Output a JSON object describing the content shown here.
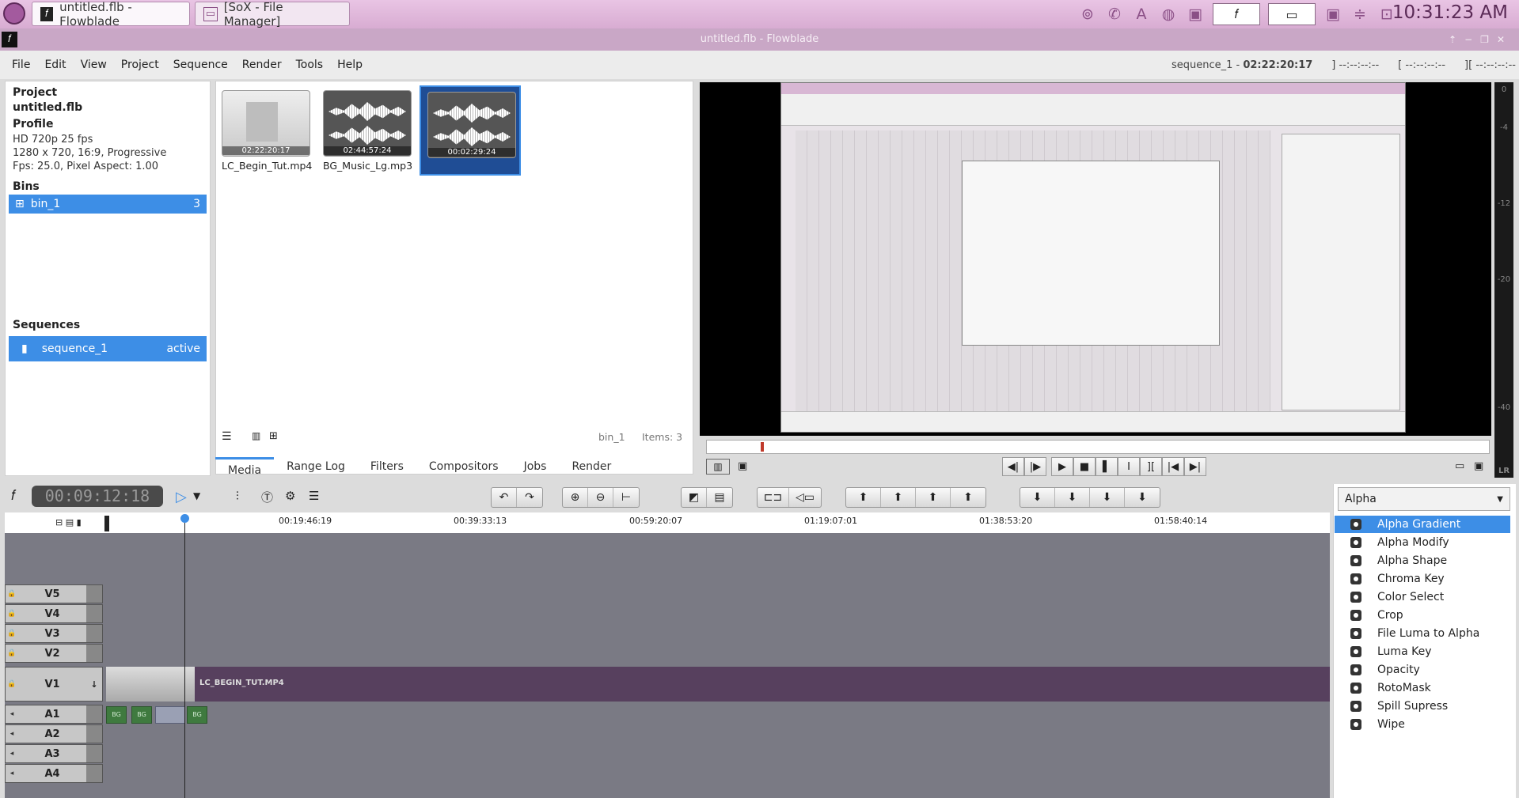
{
  "taskbar": {
    "tasks": [
      {
        "label": "untitled.flb - Flowblade"
      },
      {
        "label": "[SoX - File Manager]"
      }
    ],
    "clock": "10:31:23 AM"
  },
  "window": {
    "title": "untitled.flb - Flowblade"
  },
  "menu": [
    "File",
    "Edit",
    "View",
    "Project",
    "Sequence",
    "Render",
    "Tools",
    "Help"
  ],
  "sequence_info": {
    "name": "sequence_1 - ",
    "duration": "02:22:20:17",
    "mark_in": "] --:--:--:--",
    "mark_out": "[ --:--:--:--",
    "length": "][ --:--:--:--"
  },
  "project": {
    "project_heading": "Project",
    "file": "untitled.flb",
    "profile_heading": "Profile",
    "profile_lines": [
      "HD 720p 25 fps",
      "1280 x 720, 16:9, Progressive",
      "Fps: 25.0, Pixel Aspect: 1.00"
    ],
    "bins_heading": "Bins",
    "bin": {
      "name": "bin_1",
      "count": "3"
    },
    "sequences_heading": "Sequences",
    "sequence": {
      "name": "sequence_1",
      "status": "active"
    }
  },
  "media": {
    "clips": [
      {
        "name": "LC_Begin_Tut.mp4",
        "tc": "02:22:20:17"
      },
      {
        "name": "BG_Music_Lg.mp3",
        "tc": "02:44:57:24"
      },
      {
        "name": "",
        "tc": "00:02:29:24"
      }
    ],
    "bin_label": "bin_1",
    "items_label": "Items: 3"
  },
  "tabs": [
    "Media",
    "Range Log",
    "Filters",
    "Compositors",
    "Jobs",
    "Render"
  ],
  "meter_labels": [
    "0",
    "-4",
    "-12",
    "-20",
    "-40"
  ],
  "meter_lr": "LR",
  "timeline": {
    "timecode": "00:09:12:18",
    "ticks": [
      "00:19:46:19",
      "00:39:33:13",
      "00:59:20:07",
      "01:19:07:01",
      "01:38:53:20",
      "01:58:40:14"
    ],
    "tracks": [
      "V5",
      "V4",
      "V3",
      "V2",
      "V1",
      "A1",
      "A2",
      "A3",
      "A4"
    ],
    "v1_clip_label": "LC_BEGIN_TUT.MP4",
    "audio_clip_label": "BG"
  },
  "filters": {
    "category": "Alpha",
    "items": [
      "Alpha Gradient",
      "Alpha Modify",
      "Alpha Shape",
      "Chroma Key",
      "Color Select",
      "Crop",
      "File Luma to Alpha",
      "Luma Key",
      "Opacity",
      "RotoMask",
      "Spill Supress",
      "Wipe"
    ]
  }
}
